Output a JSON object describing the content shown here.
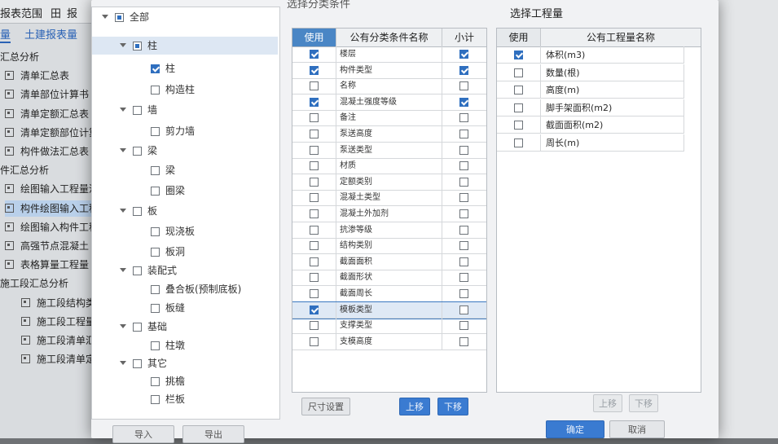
{
  "background_app": {
    "topbar": {
      "report_range": "报表范围",
      "report_icon_label": "报"
    },
    "tabs": [
      {
        "label": "量"
      },
      {
        "label": "土建报表量"
      }
    ],
    "list": [
      {
        "label": "汇总分析",
        "kind": "group"
      },
      {
        "label": "清单汇总表",
        "kind": "item"
      },
      {
        "label": "清单部位计算书",
        "kind": "item"
      },
      {
        "label": "清单定额汇总表",
        "kind": "item"
      },
      {
        "label": "清单定额部位计算书",
        "kind": "item"
      },
      {
        "label": "构件做法汇总表",
        "kind": "item"
      },
      {
        "label": "件汇总分析",
        "kind": "group"
      },
      {
        "label": "绘图输入工程量汇总表",
        "kind": "item"
      },
      {
        "label": "构件绘图输入工程量",
        "kind": "item",
        "selected": true
      },
      {
        "label": "绘图输入构件工程量",
        "kind": "item"
      },
      {
        "label": "高强节点混凝土",
        "kind": "item"
      },
      {
        "label": "表格算量工程量",
        "kind": "item"
      },
      {
        "label": "施工段汇总分析",
        "kind": "group"
      },
      {
        "label": "施工段结构类型",
        "kind": "item"
      },
      {
        "label": "施工段工程量",
        "kind": "item"
      },
      {
        "label": "施工段清单汇总",
        "kind": "item"
      },
      {
        "label": "施工段清单定额",
        "kind": "item"
      }
    ]
  },
  "dialog": {
    "tree": [
      {
        "label": "全部",
        "level": 0,
        "arrow": true,
        "state": "partial"
      },
      {
        "label": "柱",
        "level": 1,
        "arrow": true,
        "state": "partial",
        "selected": true
      },
      {
        "label": "柱",
        "level": 2,
        "arrow": false,
        "state": "checked"
      },
      {
        "label": "构造柱",
        "level": 2,
        "arrow": false,
        "state": "unchecked"
      },
      {
        "label": "墙",
        "level": 1,
        "arrow": true,
        "state": "unchecked"
      },
      {
        "label": "剪力墙",
        "level": 2,
        "arrow": false,
        "state": "unchecked"
      },
      {
        "label": "梁",
        "level": 1,
        "arrow": true,
        "state": "unchecked"
      },
      {
        "label": "梁",
        "level": 2,
        "arrow": false,
        "state": "unchecked"
      },
      {
        "label": "圈梁",
        "level": 2,
        "arrow": false,
        "state": "unchecked"
      },
      {
        "label": "板",
        "level": 1,
        "arrow": true,
        "state": "unchecked"
      },
      {
        "label": "现浇板",
        "level": 2,
        "arrow": false,
        "state": "unchecked"
      },
      {
        "label": "板洞",
        "level": 2,
        "arrow": false,
        "state": "unchecked"
      },
      {
        "label": "装配式",
        "level": 1,
        "arrow": true,
        "state": "unchecked"
      },
      {
        "label": "叠合板(预制底板)",
        "level": 2,
        "arrow": false,
        "state": "unchecked"
      },
      {
        "label": "板缝",
        "level": 2,
        "arrow": false,
        "state": "unchecked"
      },
      {
        "label": "基础",
        "level": 1,
        "arrow": true,
        "state": "unchecked"
      },
      {
        "label": "柱墩",
        "level": 2,
        "arrow": false,
        "state": "unchecked"
      },
      {
        "label": "其它",
        "level": 1,
        "arrow": true,
        "state": "unchecked"
      },
      {
        "label": "挑檐",
        "level": 2,
        "arrow": false,
        "state": "unchecked"
      },
      {
        "label": "栏板",
        "level": 2,
        "arrow": false,
        "state": "unchecked"
      }
    ],
    "middle": {
      "title": "选择分类条件",
      "headers": {
        "use": "使用",
        "name": "公有分类条件名称",
        "subtotal": "小计"
      },
      "rows": [
        {
          "name": "楼层",
          "use": true,
          "subtotal": true
        },
        {
          "name": "构件类型",
          "use": true,
          "subtotal": true
        },
        {
          "name": "名称",
          "use": false,
          "subtotal": false
        },
        {
          "name": "混凝土强度等级",
          "use": true,
          "subtotal": true
        },
        {
          "name": "备注",
          "use": false,
          "subtotal": false
        },
        {
          "name": "泵送高度",
          "use": false,
          "subtotal": false
        },
        {
          "name": "泵送类型",
          "use": false,
          "subtotal": false
        },
        {
          "name": "材质",
          "use": false,
          "subtotal": false
        },
        {
          "name": "定额类别",
          "use": false,
          "subtotal": false
        },
        {
          "name": "混凝土类型",
          "use": false,
          "subtotal": false
        },
        {
          "name": "混凝土外加剂",
          "use": false,
          "subtotal": false
        },
        {
          "name": "抗渗等级",
          "use": false,
          "subtotal": false
        },
        {
          "name": "结构类别",
          "use": false,
          "subtotal": false
        },
        {
          "name": "截面面积",
          "use": false,
          "subtotal": false
        },
        {
          "name": "截面形状",
          "use": false,
          "subtotal": false
        },
        {
          "name": "截面周长",
          "use": false,
          "subtotal": false
        },
        {
          "name": "模板类型",
          "use": true,
          "subtotal": false,
          "selected": true
        },
        {
          "name": "支撑类型",
          "use": false,
          "subtotal": false
        },
        {
          "name": "支模高度",
          "use": false,
          "subtotal": false
        }
      ],
      "buttons": {
        "size_settings": "尺寸设置",
        "move_up": "上移",
        "move_down": "下移"
      }
    },
    "right": {
      "title": "选择工程量",
      "headers": {
        "use": "使用",
        "name": "公有工程量名称"
      },
      "rows": [
        {
          "name": "体积(m3)",
          "use": true
        },
        {
          "name": "数量(根)",
          "use": false
        },
        {
          "name": "高度(m)",
          "use": false
        },
        {
          "name": "脚手架面积(m2)",
          "use": false
        },
        {
          "name": "截面面积(m2)",
          "use": false
        },
        {
          "name": "周长(m)",
          "use": false
        }
      ],
      "buttons": {
        "move_up": "上移",
        "move_down": "下移"
      }
    },
    "footer": {
      "import": "导入",
      "export": "导出",
      "ok": "确定",
      "cancel": "取消"
    }
  }
}
